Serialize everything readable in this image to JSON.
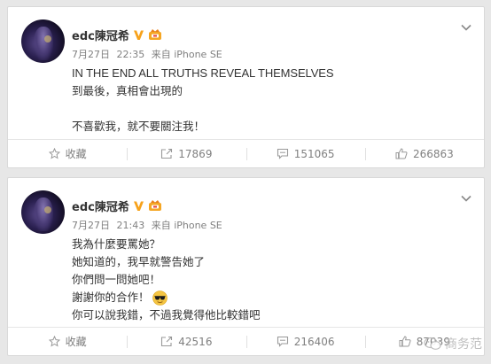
{
  "posts": [
    {
      "username": "edc陳冠希",
      "date": "7月27日",
      "time": "22:35",
      "source": "来自 iPhone SE",
      "lines": [
        "IN THE END ALL TRUTHS REVEAL THEMSELVES",
        "到最後，真相會出現的",
        "",
        "不喜歡我，就不要關注我！"
      ],
      "actions": {
        "favorite": "收藏",
        "repost": "17869",
        "comment": "151065",
        "like": "266863"
      }
    },
    {
      "username": "edc陳冠希",
      "date": "7月27日",
      "time": "21:43",
      "source": "来自 iPhone SE",
      "lines": [
        "我為什麼要罵她？",
        "她知道的，我早就警告她了",
        "你們問一問她吧！",
        "謝謝你的合作！",
        "你可以說我錯，不過我覺得他比較錯吧"
      ],
      "actions": {
        "favorite": "收藏",
        "repost": "42516",
        "comment": "216406",
        "like": "87039"
      }
    }
  ],
  "watermark": "商务范",
  "colors": {
    "vip": "#f7a21b",
    "text": "#333333",
    "meta": "#808080",
    "background": "#e7e7e7"
  }
}
